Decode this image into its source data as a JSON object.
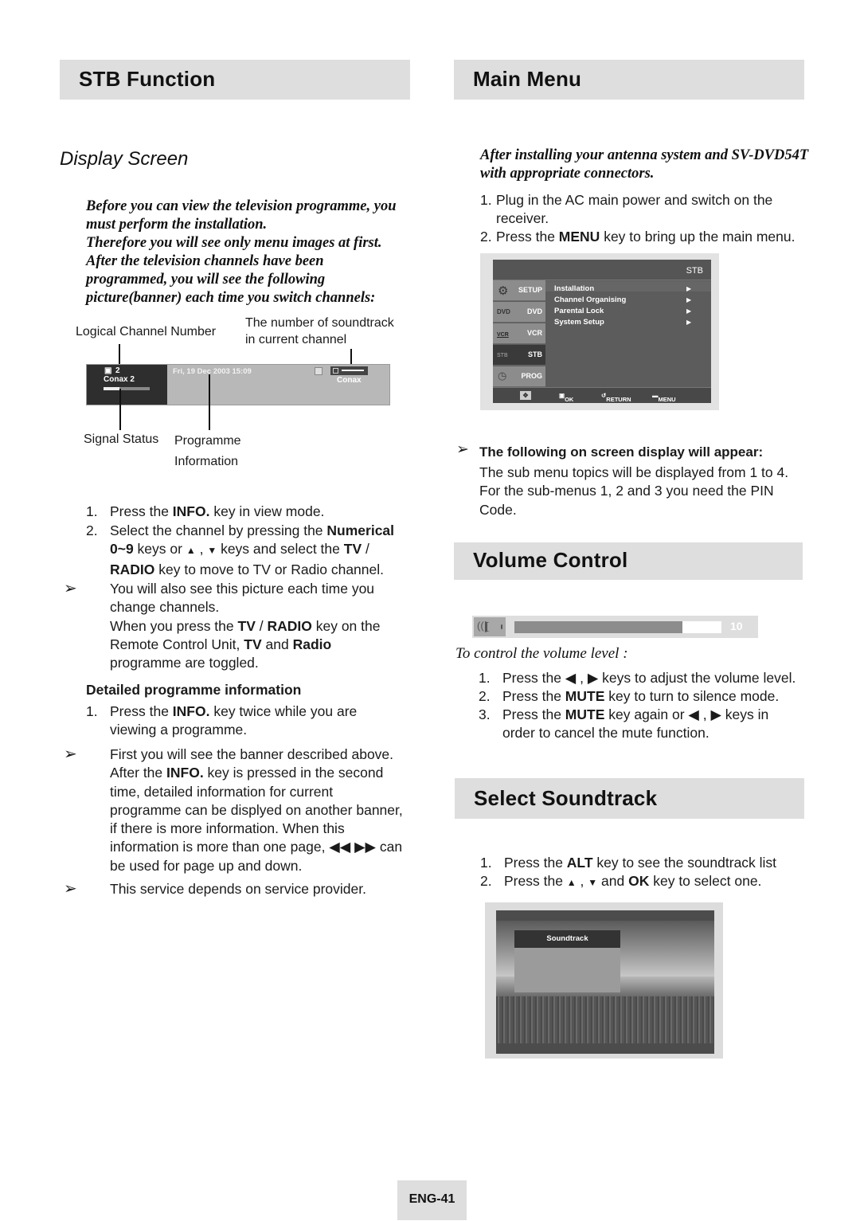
{
  "left": {
    "section_title": "STB Function",
    "subsection_title": "Display Screen",
    "intro_lines": [
      "Before you can view the television programme, you",
      "must perform the installation.",
      "Therefore you will see only menu images at first.",
      "After the television channels have been",
      "programmed, you will see the following",
      "picture(banner) each time you switch channels:"
    ],
    "diagram": {
      "label_logical_channel": "Logical Channel Number",
      "label_soundtrack_line1": "The number of soundtrack",
      "label_soundtrack_line2": "in current channel",
      "label_signal_status": "Signal Status",
      "label_programme_line1": "Programme",
      "label_programme_line2": "Information",
      "banner": {
        "channel_number": "2",
        "channel_name": "Conax 2",
        "datetime": "Fri, 19 Dec 2003 15:09",
        "ca_system": "Conax",
        "signal_level": 0.35
      }
    },
    "steps": [
      {
        "num": "1.",
        "text": "Press the INFO. key in view mode."
      },
      {
        "num": "2.",
        "lines": [
          "Select the channel by pressing the Numerical",
          "0~9 keys or ▲ , ▼  keys and select the TV /",
          "RADIO key to move to TV or Radio channel."
        ]
      }
    ],
    "note1_lines": [
      "You will also see this picture each time you",
      "change channels.",
      "When you press the TV / RADIO key on the",
      "Remote Control Unit, TV and Radio",
      "programme are toggled."
    ],
    "detail_heading": "Detailed programme information",
    "detail_step": {
      "num": "1.",
      "lines": [
        "Press the INFO. key twice while you are",
        "viewing a programme."
      ]
    },
    "note2_lines": [
      "First you will see the banner described above.",
      "After the INFO. key is pressed in the second",
      "time, detailed information for current",
      "programme can be displyed on another banner,",
      "if there is more information. When this",
      "information is more than one page, ◀◀ ▶▶ can",
      "be used for page up and down."
    ],
    "note3": "This service depends on service provider.",
    "note_arrow": "➢"
  },
  "right": {
    "main_menu": {
      "section_title": "Main Menu",
      "intro_lines": [
        "After installing your antenna system and SV-DVD54T",
        "with appropriate connectors."
      ],
      "steps": [
        {
          "num": "1.",
          "lines": [
            "Plug in the AC main power and switch on the",
            "receiver."
          ]
        },
        {
          "num": "2.",
          "lines": [
            "Press the MENU key to bring up the main menu."
          ]
        }
      ],
      "screen": {
        "header": "STB",
        "side_items": [
          "SETUP",
          "DVD",
          "VCR",
          "STB",
          "PROG"
        ],
        "side_selected": "STB",
        "items": [
          "Installation",
          "Channel Organising",
          "Parental Lock",
          "System Setup"
        ],
        "footer": {
          "ok": "OK",
          "return": "RETURN",
          "menu": "MENU"
        }
      },
      "note_heading": "The following on screen display will appear:",
      "note_lines": [
        "The sub menu topics will be displayed from 1 to 4.",
        "For the sub-menus 1, 2 and 3 you need the PIN",
        "Code."
      ]
    },
    "volume": {
      "section_title": "Volume Control",
      "level": 10,
      "fill_fraction": 0.81,
      "instruction_title": "To control the volume level :",
      "steps": [
        {
          "num": "1.",
          "lines": [
            "Press the ◀ , ▶ keys to adjust the volume level."
          ]
        },
        {
          "num": "2.",
          "lines": [
            "Press the MUTE key to turn to silence mode."
          ]
        },
        {
          "num": "3.",
          "lines": [
            "Press the MUTE key again or ◀ , ▶ keys in",
            "order to cancel the mute function."
          ]
        }
      ]
    },
    "soundtrack": {
      "section_title": "Select Soundtrack",
      "steps": [
        {
          "num": "1.",
          "lines": [
            "Press the ALT key to see the soundtrack list"
          ]
        },
        {
          "num": "2.",
          "lines": [
            "Press the  ▲ , ▼  and OK key to select one."
          ]
        }
      ],
      "panel_title": "Soundtrack"
    }
  },
  "footer": {
    "page_label": "ENG-41"
  }
}
